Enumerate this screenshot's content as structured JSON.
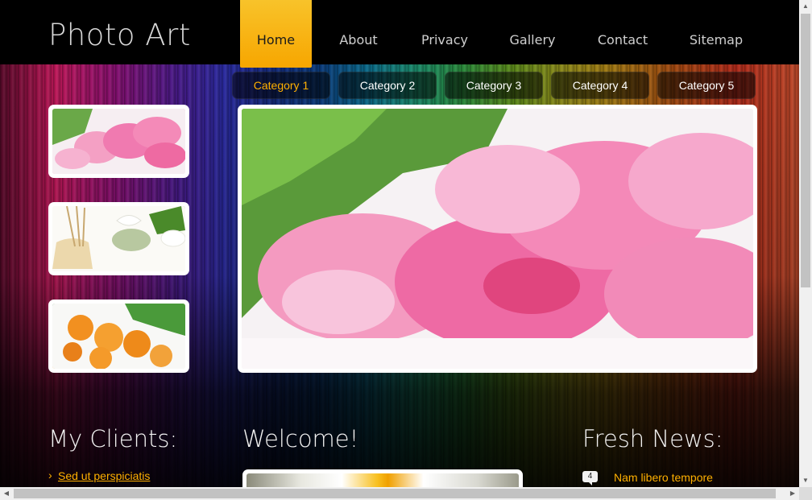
{
  "header": {
    "logo": "Photo Art",
    "nav": [
      {
        "label": "Home",
        "active": true
      },
      {
        "label": "About",
        "active": false
      },
      {
        "label": "Privacy",
        "active": false
      },
      {
        "label": "Gallery",
        "active": false
      },
      {
        "label": "Contact",
        "active": false
      },
      {
        "label": "Sitemap",
        "active": false
      }
    ]
  },
  "categories": [
    {
      "label": "Category 1",
      "active": true
    },
    {
      "label": "Category 2",
      "active": false
    },
    {
      "label": "Category 3",
      "active": false
    },
    {
      "label": "Category 4",
      "active": false
    },
    {
      "label": "Category 5",
      "active": false
    }
  ],
  "sections": {
    "clients": {
      "title": "My Clients:",
      "links": [
        "Sed ut perspiciatis"
      ]
    },
    "welcome": {
      "title": "Welcome!"
    },
    "news": {
      "title": "Fresh News:",
      "items": [
        {
          "badge": "4",
          "text": "Nam libero tempore"
        }
      ]
    }
  },
  "colors": {
    "accent": "#ffb000",
    "nav_active": "#f7a600"
  },
  "icons": {
    "client_bullet": "chevron-right-icon",
    "news_badge": "comment-bubble-icon"
  }
}
